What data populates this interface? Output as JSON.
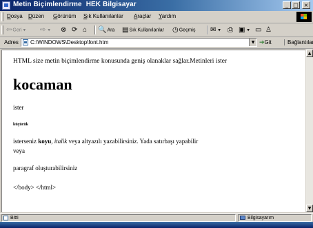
{
  "window": {
    "title": "Metin Biçimlendirme",
    "title_suffix": "HEK Bilgisayar",
    "min_symbol": "_",
    "max_symbol": "□",
    "close_symbol": "×"
  },
  "menu": {
    "items": [
      {
        "ul": "D",
        "rest": "osya"
      },
      {
        "ul": "D",
        "rest": "üzen"
      },
      {
        "ul": "G",
        "rest": "örünüm"
      },
      {
        "ul": "S",
        "rest": "ık Kullanılanlar"
      },
      {
        "ul": "A",
        "rest": "raçlar"
      },
      {
        "ul": "Y",
        "rest": "ardım"
      }
    ]
  },
  "toolbar": {
    "back_label": "Geri",
    "forward_label": "",
    "search_label": "Ara",
    "favorites_label": "Sık Kullanılanlar",
    "history_label": "Geçmiş"
  },
  "address": {
    "label": "Adres",
    "url": "C:\\WINDOWS\\Desktop\\font.htm",
    "go_label": "Git",
    "links_label": "Bağlantılar"
  },
  "content": {
    "intro": "HTML size metin biçimlendirme konusunda geniş olanaklar sağlar.Metinleri ister",
    "big": "kocaman",
    "ister": "ister",
    "small": "küçücük",
    "line5_pre": "isterseniz ",
    "line5_bold": "koyu",
    "line5_mid": ", ",
    "line5_italic": "italik",
    "line5_post": " veya altyazılı yazabilirsiniz. Yada satırbaşı yapabilir",
    "line6": "veya",
    "line7": "paragraf oluşturabilirsiniz",
    "line8": "</body> </html>"
  },
  "status": {
    "left": "Bitti",
    "right": "Bilgisayarım"
  }
}
